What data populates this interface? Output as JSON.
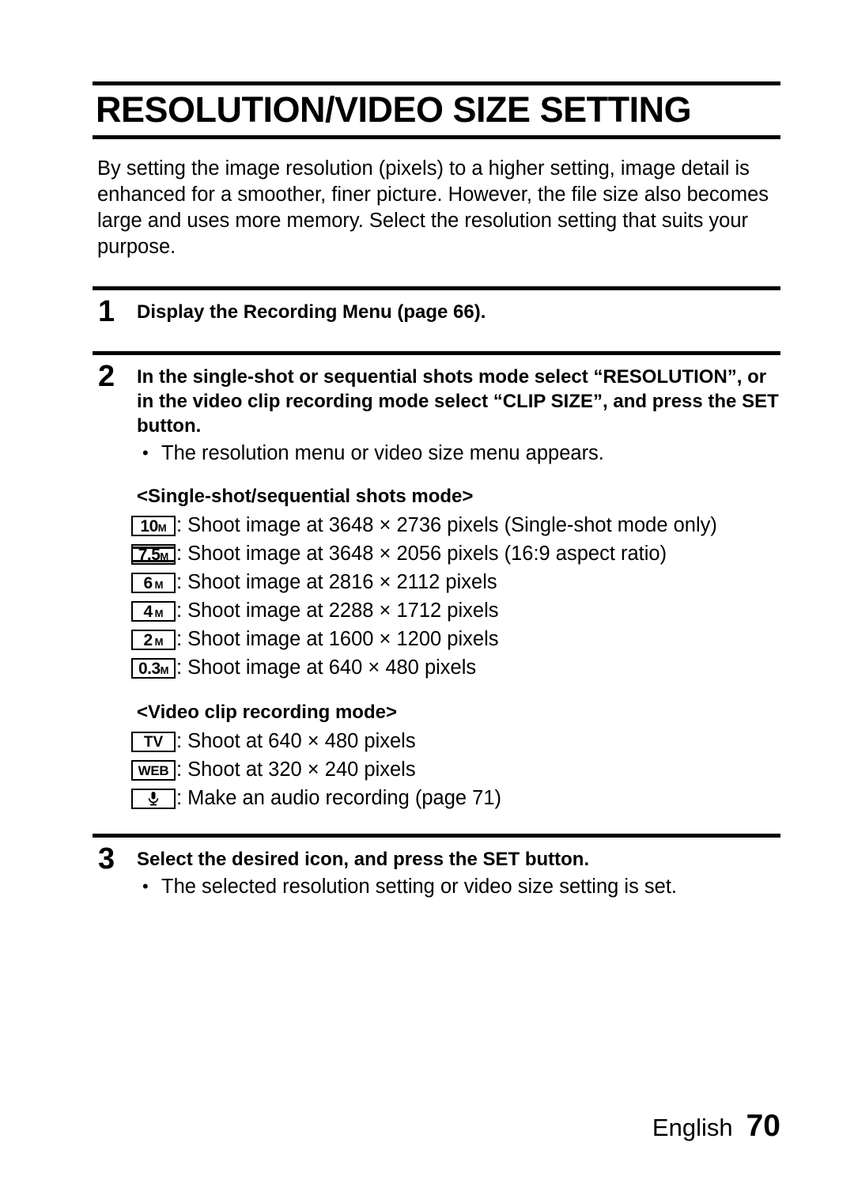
{
  "document": {
    "title": "RESOLUTION/VIDEO SIZE SETTING",
    "intro": "By setting the image resolution (pixels) to a higher setting, image detail is enhanced for a smoother, finer picture. However, the file size also becomes large and uses more memory. Select the resolution setting that suits your purpose."
  },
  "steps": [
    {
      "number": "1",
      "title": "Display the Recording Menu (page 66).",
      "note": ""
    },
    {
      "number": "2",
      "title": "In the single-shot or sequential shots mode select “RESOLUTION”, or in the video clip recording mode select “CLIP SIZE”, and press the SET button.",
      "note": "The resolution menu or video size menu appears."
    },
    {
      "number": "3",
      "title": "Select the desired icon, and press the SET button.",
      "note": "The selected resolution setting or video size setting is set."
    }
  ],
  "bullet_char": "•",
  "colon": ":",
  "sections": [
    {
      "heading": "<Single-shot/sequential shots mode>",
      "rows": [
        {
          "icon_big": "10",
          "icon_small": "M",
          "icon_name": "resolution-10m-icon",
          "description": "Shoot image at 3648 × 2736 pixels (Single-shot mode only)"
        },
        {
          "icon_big": "7.5",
          "icon_small": "M",
          "icon_name": "resolution-7-5m-icon",
          "description": "Shoot image at 3648 × 2056 pixels (16:9 aspect ratio)"
        },
        {
          "icon_big": "6",
          "icon_small": "M",
          "icon_name": "resolution-6m-icon",
          "description": "Shoot image at 2816 × 2112 pixels"
        },
        {
          "icon_big": "4",
          "icon_small": "M",
          "icon_name": "resolution-4m-icon",
          "description": "Shoot image at 2288 × 1712 pixels"
        },
        {
          "icon_big": "2",
          "icon_small": "M",
          "icon_name": "resolution-2m-icon",
          "description": "Shoot image at 1600 × 1200 pixels"
        },
        {
          "icon_big": "0.3",
          "icon_small": "M",
          "icon_name": "resolution-0-3m-icon",
          "description": "Shoot image at 640 × 480 pixels"
        }
      ]
    },
    {
      "heading": "<Video clip recording mode>",
      "rows": [
        {
          "icon_label": "TV",
          "icon_name": "video-size-tv-icon",
          "description": "Shoot at 640 × 480 pixels"
        },
        {
          "icon_label": "WEB",
          "icon_name": "video-size-web-icon",
          "description": "Shoot at 320 × 240 pixels"
        },
        {
          "icon_label": "",
          "icon_name": "audio-recording-microphone-icon",
          "description": "Make an audio recording (page 71)"
        }
      ]
    }
  ],
  "footer": {
    "language": "English",
    "page_number": "70"
  },
  "colors": {
    "text": "#000000",
    "background": "#ffffff",
    "rule": "#000000"
  }
}
